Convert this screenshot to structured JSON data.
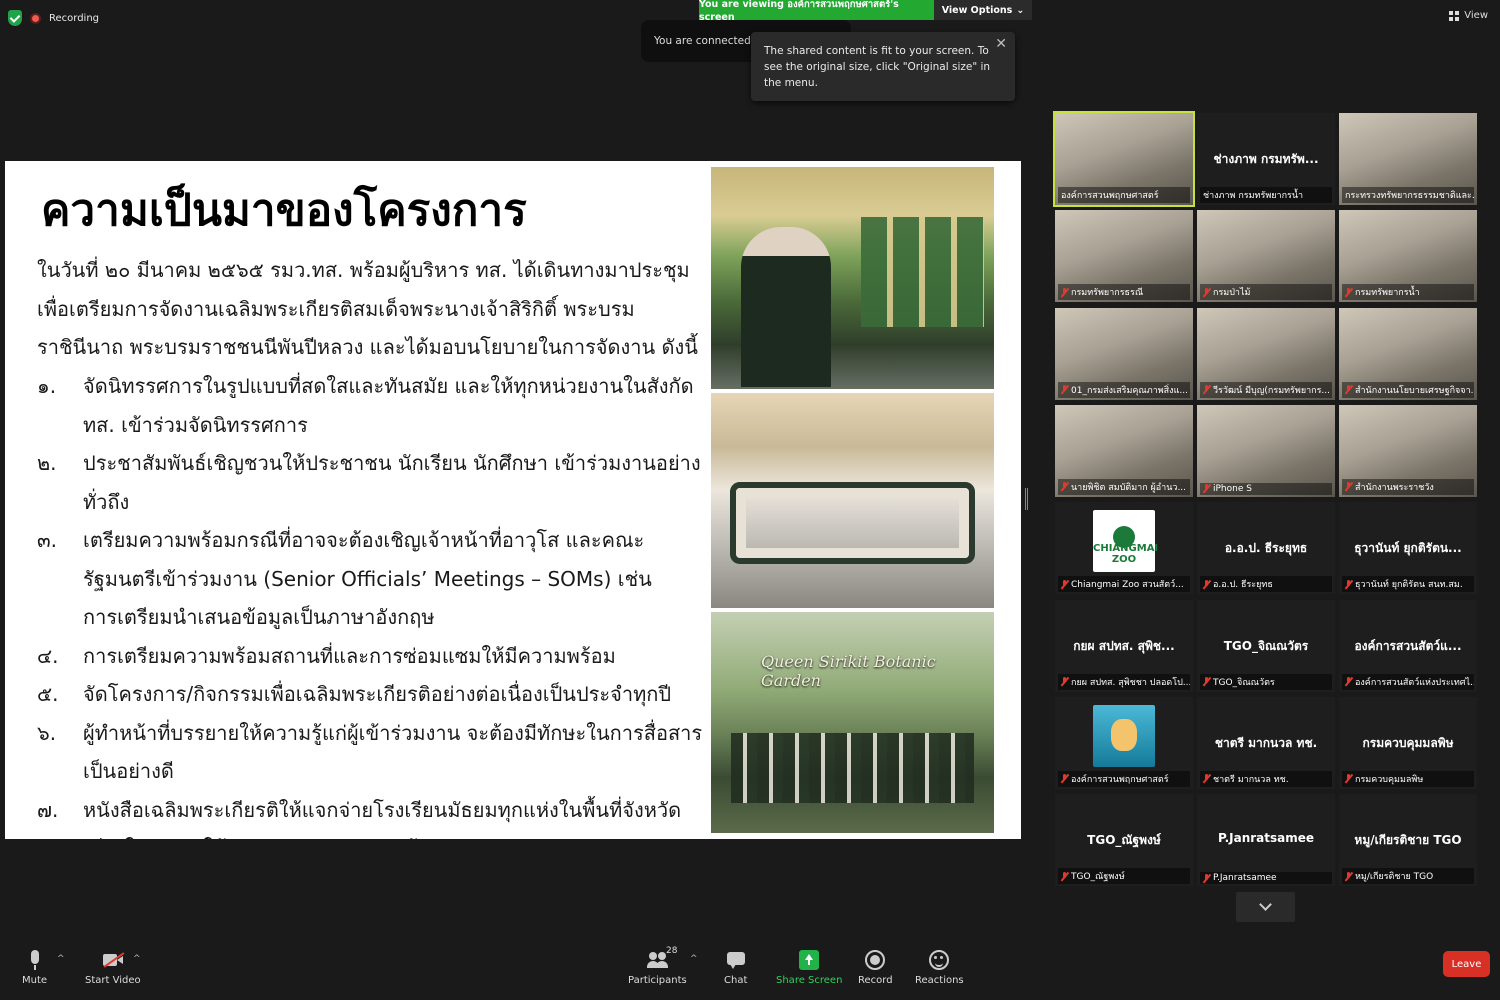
{
  "top": {
    "recording_label": "Recording",
    "viewing_banner": "You are viewing องค์การสวนพฤกษศาสตร์'s screen",
    "view_options": "View Options",
    "view_label": "View",
    "connected_text": "You are connected to computer audio",
    "tooltip_text": "The shared content is fit to your screen. To see the original size, click \"Original size\" in the menu."
  },
  "slide": {
    "title": "ความเป็นมาของโครงการ",
    "intro": "ในวันที่ ๒๐ มีนาคม ๒๕๖๕ รมว.ทส. พร้อมผู้บริหาร ทส. ได้เดินทางมาประชุมเพื่อเตรียมการจัดงานเฉลิมพระเกียรติสมเด็จพระนางเจ้าสิริกิติ์ พระบรมราชินีนาถ พระบรมราชชนนีพันปีหลวง และได้มอบนโยบายในการจัดงาน ดังนี้",
    "items": [
      {
        "num": "๑.",
        "text": "จัดนิทรรศการในรูปแบบที่สดใสและทันสมัย และให้ทุกหน่วยงานในสังกัด ทส. เข้าร่วมจัดนิทรรศการ"
      },
      {
        "num": "๒.",
        "text": "ประชาสัมพันธ์เชิญชวนให้ประชาชน นักเรียน นักศึกษา เข้าร่วมงานอย่างทั่วถึง"
      },
      {
        "num": "๓.",
        "text": "เตรียมความพร้อมกรณีที่อาจจะต้องเชิญเจ้าหน้าที่อาวุโส และคณะรัฐมนตรีเข้าร่วมงาน (Senior Officials’ Meetings – SOMs) เช่น การเตรียมนำเสนอข้อมูลเป็นภาษาอังกฤษ"
      },
      {
        "num": "๔.",
        "text": "การเตรียมความพร้อมสถานที่และการซ่อมแซมให้มีความพร้อม"
      },
      {
        "num": "๕.",
        "text": "จัดโครงการ/กิจกรรมเพื่อเฉลิมพระเกียรติอย่างต่อเนื่องเป็นประจำทุกปี"
      },
      {
        "num": "๖.",
        "text": "ผู้ทำหน้าที่บรรยายให้ความรู้แก่ผู้เข้าร่วมงาน จะต้องมีทักษะในการสื่อสารเป็นอย่างดี"
      },
      {
        "num": "๗.",
        "text": "หนังสือเฉลิมพระเกียรติให้แจกจ่ายโรงเรียนมัธยมทุกแห่งในพื้นที่จังหวัดเชียงใหม่ และให้เผยแพร่ทาง Online ด้วย"
      }
    ],
    "photo3_sign": "Queen Sirikit Botanic Garden"
  },
  "participants": [
    {
      "big": "",
      "caption": "องค์การสวนพฤกษศาสตร์",
      "video": true,
      "muted": false,
      "active": true
    },
    {
      "big": "ช่างภาพ กรมทรัพ...",
      "caption": "ช่างภาพ กรมทรัพยากรน้ำ",
      "video": false,
      "muted": false
    },
    {
      "big": "",
      "caption": "กระทรวงทรัพยากรธรรมชาติและ...",
      "video": true,
      "muted": false
    },
    {
      "big": "",
      "caption": "กรมทรัพยากรธรณี",
      "video": true,
      "muted": true
    },
    {
      "big": "",
      "caption": "กรมป่าไม้",
      "video": true,
      "muted": true
    },
    {
      "big": "",
      "caption": "กรมทรัพยากรน้ำ",
      "video": true,
      "muted": true
    },
    {
      "big": "",
      "caption": "01_กรมส่งเสริมคุณภาพสิ่งแ...",
      "video": true,
      "muted": true
    },
    {
      "big": "",
      "caption": "วีรวัฒน์ มีบุญ(กรมทรัพยากร...",
      "video": true,
      "muted": true
    },
    {
      "big": "",
      "caption": "สำนักงานนโยบายเศรษฐกิจจา...",
      "video": true,
      "muted": true
    },
    {
      "big": "",
      "caption": "นายพิชิต สมบัติมาก ผู้อำนว...",
      "video": true,
      "muted": true
    },
    {
      "big": "",
      "caption": "iPhone S",
      "video": true,
      "muted": true
    },
    {
      "big": "",
      "caption": "สำนักงานพระราชวัง",
      "video": true,
      "muted": true
    },
    {
      "big": "",
      "caption": "Chiangmai Zoo สวนสัตว์...",
      "video": false,
      "muted": true,
      "logo": "zoo",
      "logo_text": "CHIANGMAI ZOO"
    },
    {
      "big": "อ.อ.ป. ธีระยุทธ",
      "caption": "อ.อ.ป. ธีระยุทธ",
      "video": false,
      "muted": true
    },
    {
      "big": "ธุวานันท์ ยุกติรัตน...",
      "caption": "ธุวานันท์ ยุกติรัตน สนท.สม.",
      "video": false,
      "muted": true
    },
    {
      "big": "กยผ สปทส. สุพิช...",
      "caption": "กยผ สปทส. สุพิชชา ปลอดโป...",
      "video": false,
      "muted": true
    },
    {
      "big": "TGO_จิณณวัตร",
      "caption": "TGO_จิณณวัตร",
      "video": false,
      "muted": true
    },
    {
      "big": "องค์การสวนสัตว์แ...",
      "caption": "องค์การสวนสัตว์แห่งประเทศไ...",
      "video": false,
      "muted": true
    },
    {
      "big": "",
      "caption": "องค์การสวนพฤกษศาสตร์",
      "video": false,
      "muted": true,
      "logo": "aqua"
    },
    {
      "big": "ชาตรี มากนวล ทช.",
      "caption": "ชาตรี มากนวล ทช.",
      "video": false,
      "muted": true
    },
    {
      "big": "กรมควบคุมมลพิษ",
      "caption": "กรมควบคุมมลพิษ",
      "video": false,
      "muted": true
    },
    {
      "big": "TGO_ณัฐพงษ์",
      "caption": "TGO_ณัฐพงษ์",
      "video": false,
      "muted": true
    },
    {
      "big": "P.Janratsamee",
      "caption": "P.Janratsamee",
      "video": false,
      "muted": true
    },
    {
      "big": "หมู/เกียรติชาย TGO",
      "caption": "หมู/เกียรติชาย TGO",
      "video": false,
      "muted": true
    }
  ],
  "toolbar": {
    "mute": "Mute",
    "start_video": "Start Video",
    "participants": "Participants",
    "participant_count": "28",
    "chat": "Chat",
    "share_screen": "Share Screen",
    "record": "Record",
    "reactions": "Reactions",
    "leave": "Leave"
  }
}
